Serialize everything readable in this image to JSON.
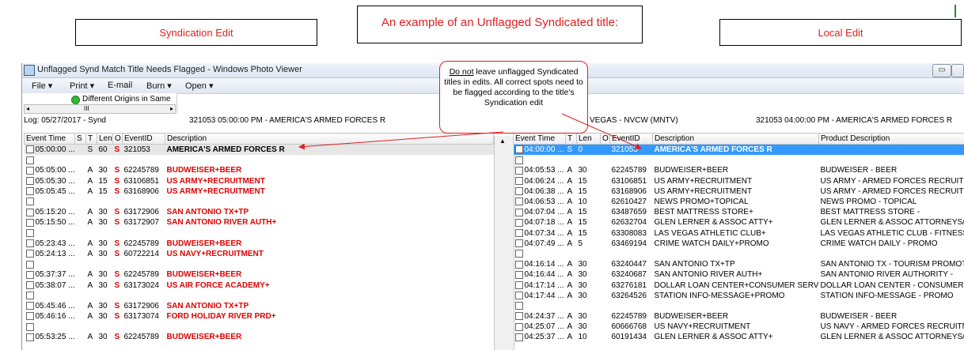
{
  "labels": {
    "syndication_edit": "Syndication Edit",
    "title": "An example of an Unflagged Syndicated title:",
    "local_edit": "Local Edit"
  },
  "window": {
    "title": "Unflagged Synd Match Title Needs Flagged - Windows Photo Viewer",
    "menu": [
      "File ▾",
      "Print ▾",
      "E-mail",
      "Burn ▾",
      "Open ▾"
    ]
  },
  "tree": {
    "node": "Different Origins in Same",
    "scroll_mark": "III"
  },
  "log": {
    "left_date": "Log: 05/27/2017 - Synd",
    "left_event": "321053 05:00:00 PM - AMERICA'S ARMED FORCES R",
    "right_station": "VEGAS - NVCW (MNTV)",
    "right_event": "321053 04:00:00 PM - AMERICA'S ARMED FORCES R"
  },
  "callout": {
    "lead": "Do not",
    "text": " leave unflagged Syndicated titles in edits.  All correct spots need to be flagged according to the title's Syndication edit"
  },
  "left_headers": [
    "Event Time",
    "S",
    "T",
    "Len",
    "O",
    "EventID",
    "Description"
  ],
  "left_rows": [
    {
      "time": "05:00:00 ...",
      "s": "",
      "t": "S",
      "len": "60",
      "o": "S",
      "id": "321053",
      "desc": "AMERICA'S ARMED FORCES R",
      "style": "title"
    },
    {
      "time": "",
      "s": "",
      "t": "",
      "len": "",
      "o": "",
      "id": "",
      "desc": "",
      "style": ""
    },
    {
      "time": "05:05:00 ...",
      "s": "",
      "t": "A",
      "len": "30",
      "o": "S",
      "id": "62245789",
      "desc": "BUDWEISER+BEER",
      "style": "red"
    },
    {
      "time": "05:05:30 ...",
      "s": "",
      "t": "A",
      "len": "15",
      "o": "S",
      "id": "63106851",
      "desc": "US ARMY+RECRUITMENT",
      "style": "red"
    },
    {
      "time": "05:05:45 ...",
      "s": "",
      "t": "A",
      "len": "15",
      "o": "S",
      "id": "63168906",
      "desc": "US ARMY+RECRUITMENT",
      "style": "red"
    },
    {
      "time": "",
      "s": "",
      "t": "",
      "len": "",
      "o": "",
      "id": "",
      "desc": "",
      "style": ""
    },
    {
      "time": "05:15:20 ...",
      "s": "",
      "t": "A",
      "len": "30",
      "o": "S",
      "id": "63172906",
      "desc": "SAN ANTONIO TX+TP",
      "style": "red"
    },
    {
      "time": "05:15:50 ...",
      "s": "",
      "t": "A",
      "len": "30",
      "o": "S",
      "id": "63172907",
      "desc": "SAN ANTONIO RIVER AUTH+",
      "style": "red"
    },
    {
      "time": "",
      "s": "",
      "t": "",
      "len": "",
      "o": "",
      "id": "",
      "desc": "",
      "style": ""
    },
    {
      "time": "05:23:43 ...",
      "s": "",
      "t": "A",
      "len": "30",
      "o": "S",
      "id": "62245789",
      "desc": "BUDWEISER+BEER",
      "style": "red"
    },
    {
      "time": "05:24:13 ...",
      "s": "",
      "t": "A",
      "len": "30",
      "o": "S",
      "id": "60722214",
      "desc": "US NAVY+RECRUITMENT",
      "style": "red"
    },
    {
      "time": "",
      "s": "",
      "t": "",
      "len": "",
      "o": "",
      "id": "",
      "desc": "",
      "style": ""
    },
    {
      "time": "05:37:37 ...",
      "s": "",
      "t": "A",
      "len": "30",
      "o": "S",
      "id": "62245789",
      "desc": "BUDWEISER+BEER",
      "style": "red"
    },
    {
      "time": "05:38:07 ...",
      "s": "",
      "t": "A",
      "len": "30",
      "o": "S",
      "id": "63173024",
      "desc": "US AIR FORCE ACADEMY+",
      "style": "red"
    },
    {
      "time": "",
      "s": "",
      "t": "",
      "len": "",
      "o": "",
      "id": "",
      "desc": "",
      "style": ""
    },
    {
      "time": "05:45:46 ...",
      "s": "",
      "t": "A",
      "len": "30",
      "o": "S",
      "id": "63172906",
      "desc": "SAN ANTONIO TX+TP",
      "style": "red"
    },
    {
      "time": "05:46:16 ...",
      "s": "",
      "t": "A",
      "len": "30",
      "o": "S",
      "id": "63173074",
      "desc": "FORD HOLIDAY RIVER PRD+",
      "style": "red"
    },
    {
      "time": "",
      "s": "",
      "t": "",
      "len": "",
      "o": "",
      "id": "",
      "desc": "",
      "style": ""
    },
    {
      "time": "05:53:25 ...",
      "s": "",
      "t": "A",
      "len": "30",
      "o": "S",
      "id": "62245789",
      "desc": "BUDWEISER+BEER",
      "style": "red"
    }
  ],
  "right_headers": [
    "Event Time",
    "T",
    "Len",
    "O",
    "EventID",
    "Description",
    "Product Description"
  ],
  "right_rows": [
    {
      "time": "04:00:00 ...",
      "t": "S",
      "len": "0",
      "o": "",
      "id": "321053",
      "desc": "AMERICA'S ARMED FORCES R",
      "prod": "",
      "style": "sel"
    },
    {
      "time": "",
      "t": "",
      "len": "",
      "o": "",
      "id": "",
      "desc": "",
      "prod": "",
      "style": ""
    },
    {
      "time": "04:05:53 ...",
      "t": "A",
      "len": "30",
      "o": "",
      "id": "62245789",
      "desc": "BUDWEISER+BEER",
      "prod": "BUDWEISER - BEER",
      "style": ""
    },
    {
      "time": "04:06:24 ...",
      "t": "A",
      "len": "15",
      "o": "",
      "id": "63106851",
      "desc": "US ARMY+RECRUITMENT",
      "prod": "US ARMY - ARMED FORCES RECRUITMENT",
      "style": ""
    },
    {
      "time": "04:06:38 ...",
      "t": "A",
      "len": "15",
      "o": "",
      "id": "63168906",
      "desc": "US ARMY+RECRUITMENT",
      "prod": "US ARMY - ARMED FORCES RECRUITMENT",
      "style": ""
    },
    {
      "time": "04:06:53 ...",
      "t": "A",
      "len": "10",
      "o": "",
      "id": "62610427",
      "desc": "NEWS PROMO+TOPICAL",
      "prod": "NEWS PROMO - TOPICAL",
      "style": ""
    },
    {
      "time": "04:07:04 ...",
      "t": "A",
      "len": "15",
      "o": "",
      "id": "63487659",
      "desc": "BEST MATTRESS STORE+",
      "prod": "BEST MATTRESS STORE -",
      "style": ""
    },
    {
      "time": "04:07:18 ...",
      "t": "A",
      "len": "15",
      "o": "",
      "id": "62632704",
      "desc": "GLEN LERNER & ASSOC ATTY+",
      "prod": "GLEN LERNER & ASSOC ATTORNEYS/PER",
      "style": ""
    },
    {
      "time": "04:07:34 ...",
      "t": "A",
      "len": "15",
      "o": "",
      "id": "63308083",
      "desc": "LAS VEGAS ATHLETIC CLUB+",
      "prod": "LAS VEGAS ATHLETIC CLUB - FITNESS CEN",
      "style": ""
    },
    {
      "time": "04:07:49 ...",
      "t": "A",
      "len": "5",
      "o": "",
      "id": "63469194",
      "desc": "CRIME WATCH DAILY+PROMO",
      "prod": "CRIME WATCH DAILY - PROMO",
      "style": ""
    },
    {
      "time": "",
      "t": "",
      "len": "",
      "o": "",
      "id": "",
      "desc": "",
      "prod": "",
      "style": ""
    },
    {
      "time": "04:16:14 ...",
      "t": "A",
      "len": "30",
      "o": "",
      "id": "63240447",
      "desc": "SAN ANTONIO TX+TP",
      "prod": "SAN ANTONIO TX - TOURISM PROMOTION",
      "style": ""
    },
    {
      "time": "04:16:44 ...",
      "t": "A",
      "len": "30",
      "o": "",
      "id": "63240687",
      "desc": "SAN ANTONIO RIVER AUTH+",
      "prod": "SAN ANTONIO RIVER AUTHORITY -",
      "style": ""
    },
    {
      "time": "04:17:14 ...",
      "t": "A",
      "len": "30",
      "o": "",
      "id": "63276181",
      "desc": "DOLLAR LOAN CENTER+CONSUMER SERVICES",
      "prod": "DOLLAR LOAN CENTER - CONSUMER SIGN",
      "style": ""
    },
    {
      "time": "04:17:44 ...",
      "t": "A",
      "len": "30",
      "o": "",
      "id": "63264526",
      "desc": "STATION INFO-MESSAGE+PROMO",
      "prod": "STATION INFO-MESSAGE - PROMO",
      "style": ""
    },
    {
      "time": "",
      "t": "",
      "len": "",
      "o": "",
      "id": "",
      "desc": "",
      "prod": "",
      "style": ""
    },
    {
      "time": "04:24:37 ...",
      "t": "A",
      "len": "30",
      "o": "",
      "id": "62245789",
      "desc": "BUDWEISER+BEER",
      "prod": "BUDWEISER - BEER",
      "style": ""
    },
    {
      "time": "04:25:07 ...",
      "t": "A",
      "len": "30",
      "o": "",
      "id": "60666768",
      "desc": "US NAVY+RECRUITMENT",
      "prod": "US NAVY - ARMED FORCES RECRUITMENT",
      "style": ""
    },
    {
      "time": "04:25:37 ...",
      "t": "A",
      "len": "10",
      "o": "",
      "id": "60191434",
      "desc": "GLEN LERNER & ASSOC ATTY+",
      "prod": "GLEN LERNER & ASSOC ATTORNEYS/PER",
      "style": ""
    }
  ]
}
